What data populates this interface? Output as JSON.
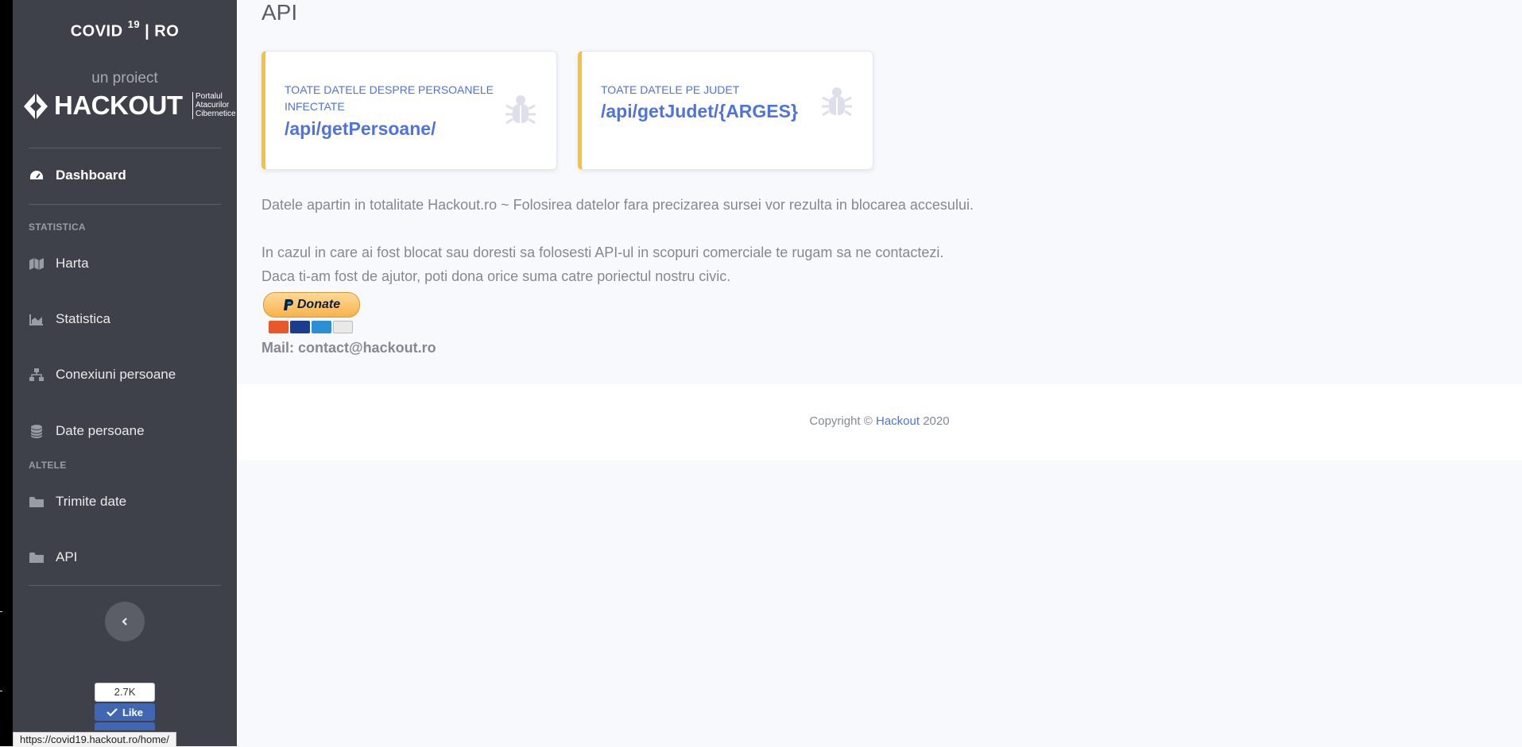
{
  "sidebar": {
    "brand": {
      "part1": "COVID ",
      "sup": "19",
      "part2": " | RO"
    },
    "subtitle": "un proiect",
    "logo": {
      "name": "HACKOUT",
      "tagline": [
        "Portalul",
        "Atacurilor",
        "Cibernetice"
      ]
    },
    "dashboard": {
      "label": "Dashboard",
      "icon": "tachometer-icon"
    },
    "headings": {
      "statistica": "STATISTICA",
      "altele": "ALTELE"
    },
    "items": [
      {
        "label": "Harta",
        "icon": "map-icon"
      },
      {
        "label": "Statistica",
        "icon": "area-chart-icon"
      },
      {
        "label": "Conexiuni persoane",
        "icon": "sitemap-icon"
      },
      {
        "label": "Date persoane",
        "icon": "database-icon"
      },
      {
        "label": "Trimite date",
        "icon": "folder-icon"
      },
      {
        "label": "API",
        "icon": "folder-icon"
      }
    ],
    "toggle_icon": "chevron-left-icon",
    "facebook": {
      "count": "2.7K",
      "like_label": "Like"
    }
  },
  "status_bar": {
    "url": "https://covid19.hackout.ro/home/"
  },
  "main": {
    "title": "API",
    "cards": [
      {
        "label": "TOATE DATELE DESPRE PERSOANELE INFECTATE",
        "value": "/api/getPersoane/",
        "icon": "bug-icon"
      },
      {
        "label": "TOATE DATELE PE JUDET",
        "value": "/api/getJudet/{ARGES}",
        "icon": "bug-icon"
      }
    ],
    "paragraphs": [
      "Datele apartin in totalitate Hackout.ro ~ Folosirea datelor fara precizarea sursei vor rezulta in blocarea accesului.",
      "In cazul in care ai fost blocat sau doresti sa folosesti API-ul in scopuri comerciale te rugam sa ne contactezi.",
      "Daca ti-am fost de ajutor, poti dona orice suma catre poriectul nostru civic."
    ],
    "donate": {
      "label": "Donate",
      "cards": [
        "mastercard",
        "visa",
        "amex",
        "discover"
      ]
    },
    "mail": "Mail: contact@hackout.ro"
  },
  "footer": {
    "prefix": "Copyright © ",
    "link": "Hackout",
    "suffix": " 2020"
  },
  "colors": {
    "sidebar": "#3e4149",
    "accent": "#4e73df",
    "card_border": "#f6c23e",
    "text_muted": "#858796"
  }
}
